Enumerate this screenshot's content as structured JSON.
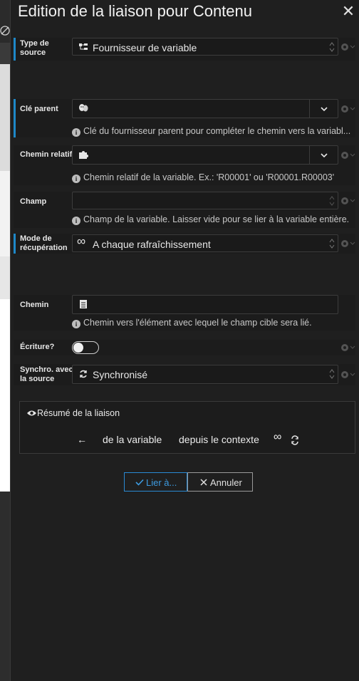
{
  "window": {
    "title": "Edition de la liaison pour Contenu",
    "close_glyph": "✕"
  },
  "fields": {
    "type_source": {
      "label_l1": "Type de",
      "label_l2": "source",
      "value": "Fournisseur de variable"
    },
    "cle_parent": {
      "label": "Clé parent",
      "value": "",
      "hint": "Clé du fournisseur parent pour compléter le chemin vers la variabl..."
    },
    "chemin_relatif": {
      "label": "Chemin relatif",
      "value": "",
      "hint": "Chemin relatif de la variable. Ex.: 'R00001' ou 'R00001.R00003'"
    },
    "champ": {
      "label": "Champ",
      "value": "",
      "hint": "Champ de la variable. Laisser vide pour se lier à la variable entière."
    },
    "mode_recuperation": {
      "label_l1": "Mode de",
      "label_l2": "récupération",
      "value": "A chaque rafraîchissement",
      "icon_glyph": "∞"
    },
    "chemin": {
      "label": "Chemin",
      "value": "",
      "hint": "Chemin vers l'élément avec lequel le champ cible sera lié."
    },
    "ecriture": {
      "label": "Écriture?",
      "checked": false
    },
    "synchro": {
      "label_l1": "Synchro. avec",
      "label_l2": "la source",
      "value": "Synchronisé"
    }
  },
  "summary": {
    "title": "Résumé de la liaison",
    "arrow": "←",
    "part1": "de la variable",
    "part2": "depuis le contexte",
    "infinity": "∞"
  },
  "buttons": {
    "lier": "Lier à...",
    "annuler": "Annuler"
  },
  "colors": {
    "accent": "#1e88c8",
    "primary_button": "#2a8ad4"
  }
}
